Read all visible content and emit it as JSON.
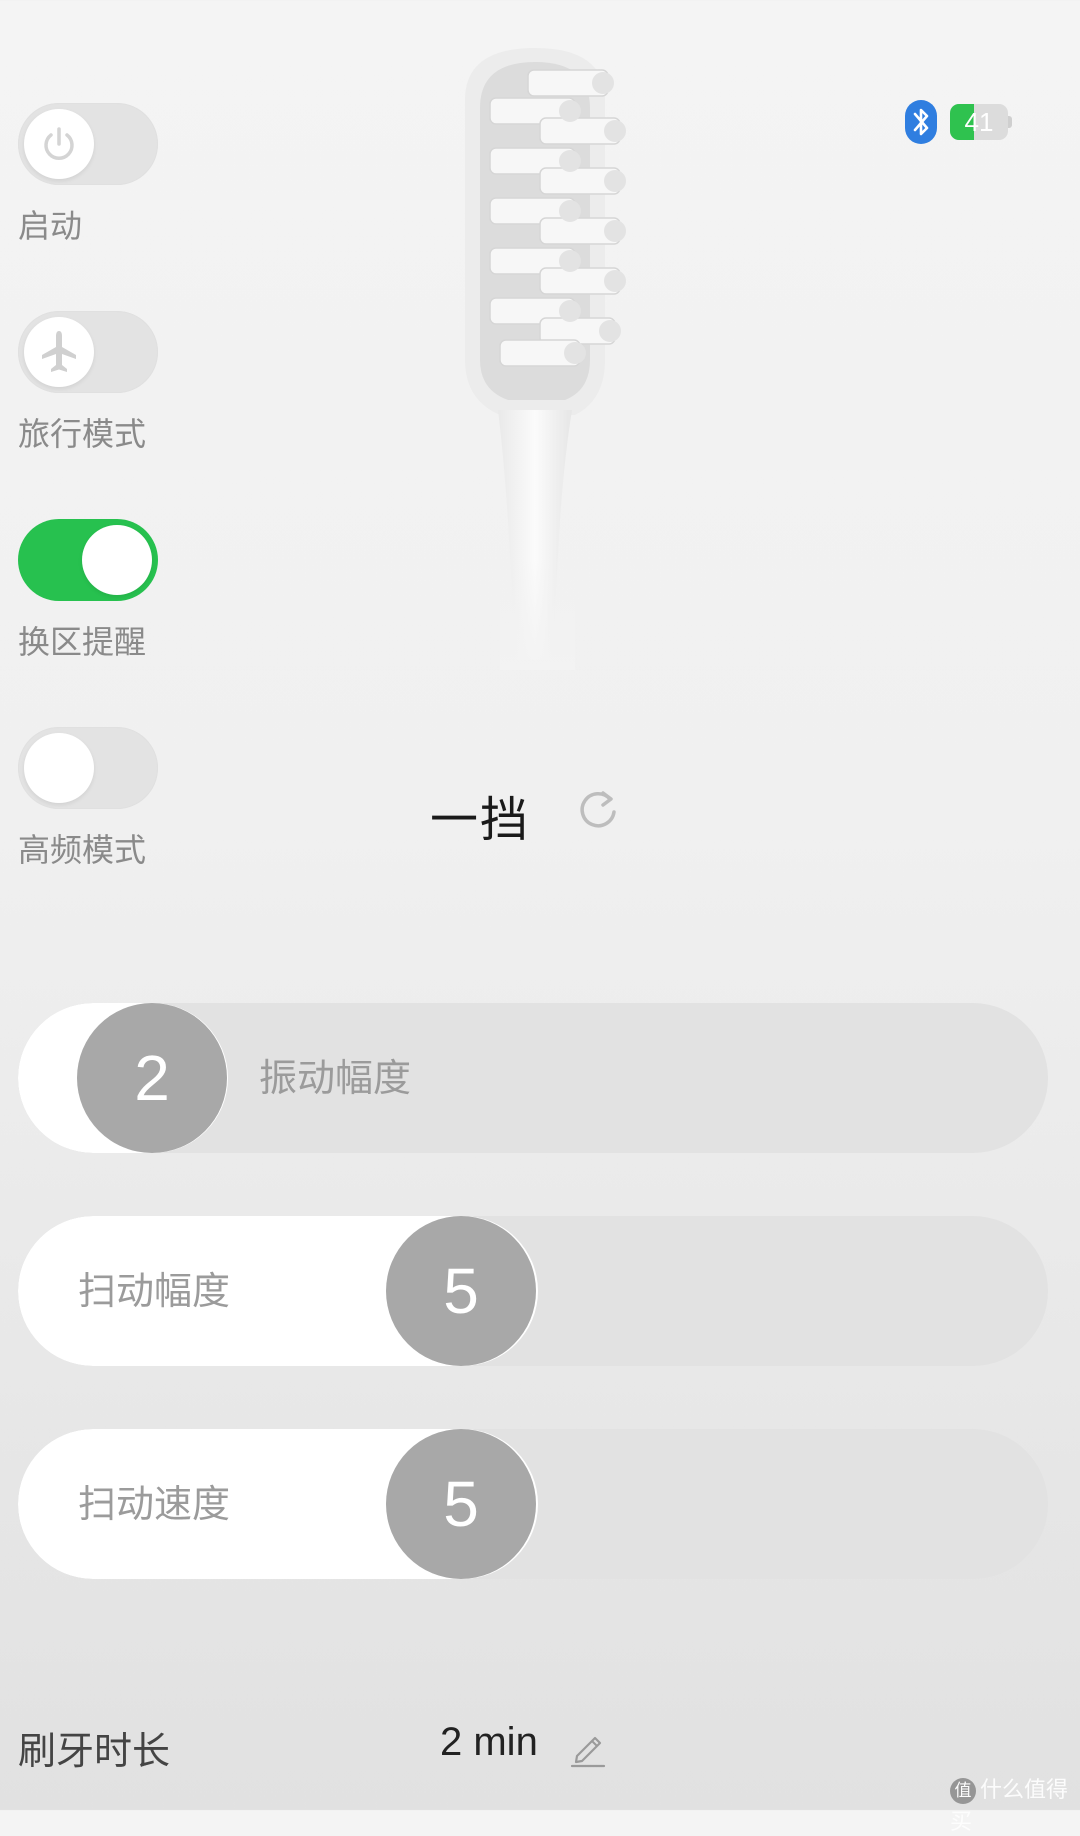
{
  "toggles": [
    {
      "label": "启动",
      "on": false,
      "icon": "power-icon"
    },
    {
      "label": "旅行模式",
      "on": false,
      "icon": "airplane-icon"
    },
    {
      "label": "换区提醒",
      "on": true,
      "icon": ""
    },
    {
      "label": "高频模式",
      "on": false,
      "icon": ""
    }
  ],
  "status": {
    "bluetooth_icon": "bluetooth-icon",
    "battery_percent": "41",
    "battery_color": "#2fc24f"
  },
  "gear": {
    "label": "一挡",
    "refresh_icon": "refresh-icon"
  },
  "sliders": [
    {
      "label": "振动幅度",
      "value": "2"
    },
    {
      "label": "扫动幅度",
      "value": "5"
    },
    {
      "label": "扫动速度",
      "value": "5"
    }
  ],
  "duration": {
    "label": "刷牙时长",
    "value": "2 min",
    "edit_icon": "pencil-icon"
  },
  "watermark": {
    "badge": "值",
    "text": "什么值得买"
  },
  "colors": {
    "accent_green": "#27c14f",
    "thumb_gray": "#a8a8a8"
  }
}
